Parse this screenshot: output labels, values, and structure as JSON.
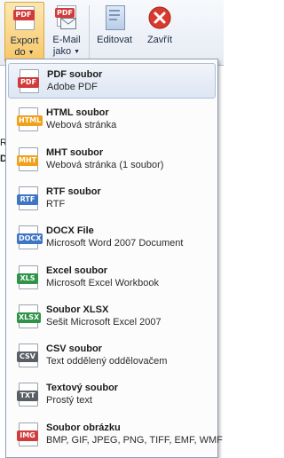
{
  "toolbar": {
    "export": {
      "line1": "Export",
      "line2": "do",
      "icon_tag": "PDF"
    },
    "email": {
      "line1": "E-Mail",
      "line2": "jako",
      "icon_tag": "PDF"
    },
    "edit": {
      "label": "Editovat"
    },
    "close": {
      "label": "Zavřít"
    }
  },
  "background": {
    "row1": "R",
    "row2": "D"
  },
  "menu": {
    "items": [
      {
        "tag": "PDF",
        "color": "#d23b3b",
        "title": "PDF soubor",
        "desc": "Adobe PDF",
        "highlighted": true
      },
      {
        "tag": "HTML",
        "color": "#f0a11c",
        "title": "HTML soubor",
        "desc": "Webová stránka"
      },
      {
        "tag": "MHT",
        "color": "#f0a11c",
        "title": "MHT soubor",
        "desc": "Webová stránka (1 soubor)"
      },
      {
        "tag": "RTF",
        "color": "#3f76c4",
        "title": "RTF soubor",
        "desc": "RTF"
      },
      {
        "tag": "DOCX",
        "color": "#3f76c4",
        "title": "DOCX File",
        "desc": "Microsoft Word 2007 Document"
      },
      {
        "tag": "XLS",
        "color": "#2e9447",
        "title": "Excel soubor",
        "desc": "Microsoft Excel Workbook"
      },
      {
        "tag": "XLSX",
        "color": "#2e9447",
        "title": "Soubor XLSX",
        "desc": "Sešit Microsoft Excel 2007"
      },
      {
        "tag": "CSV",
        "color": "#5a5f66",
        "title": "CSV soubor",
        "desc": "Text oddělený oddělovačem"
      },
      {
        "tag": "TXT",
        "color": "#5a5f66",
        "title": "Textový soubor",
        "desc": "Prostý text"
      },
      {
        "tag": "IMG",
        "color": "#d23b3b",
        "title": "Soubor obrázku",
        "desc": "BMP, GIF, JPEG, PNG, TIFF, EMF, WMF"
      }
    ]
  }
}
